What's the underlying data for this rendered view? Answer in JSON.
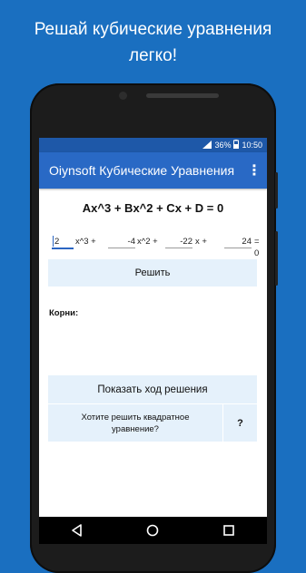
{
  "promo": {
    "line1": "Решай кубические уравнения",
    "line2": "легко!"
  },
  "status_bar": {
    "battery": "36%",
    "time": "10:50",
    "signal_icon": "signal-icon",
    "battery_icon": "battery-icon"
  },
  "app_bar": {
    "title": "Oiynsoft Кубические Уравнения",
    "menu_icon": "overflow-menu-icon"
  },
  "equation": "Ax^3 + Bx^2 + Cx + D = 0",
  "coefficients": {
    "a": "2",
    "b": "-4",
    "c": "-22",
    "d": "24",
    "a_term": "x^3 +",
    "b_term": "x^2 +",
    "c_term": "x +",
    "d_term": "= 0"
  },
  "buttons": {
    "solve": "Решить",
    "show_steps": "Показать ход решения",
    "quadratic": "Хотите решить квадратное уравнение?",
    "help": "?"
  },
  "roots_label": "Корни:",
  "nav": {
    "back_icon": "back-icon",
    "home_icon": "home-icon",
    "recents_icon": "recents-icon"
  },
  "colors": {
    "background": "#1a6fc0",
    "app_bar": "#2969c5",
    "status_bar": "#1e58a8",
    "button_bg": "#e5f1fb",
    "accent": "#2b66c3"
  }
}
